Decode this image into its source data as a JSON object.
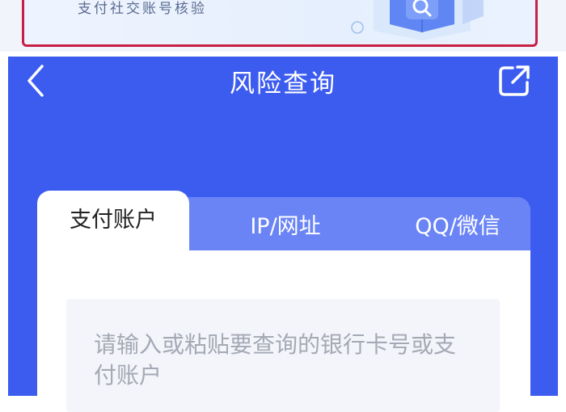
{
  "banner": {
    "subtitle": "支付社交账号核验",
    "illustration_icon": "search-cube-icon"
  },
  "nav": {
    "title": "风险查询",
    "back_icon": "chevron-left-icon",
    "share_icon": "share-external-icon"
  },
  "tabs": [
    {
      "label": "支付账户",
      "active": true
    },
    {
      "label": "IP/网址",
      "active": false
    },
    {
      "label": "QQ/微信",
      "active": false
    }
  ],
  "input": {
    "placeholder": "请输入或粘贴要查询的银行卡号或支付账户",
    "value": ""
  },
  "colors": {
    "primary_blue": "#3c5cf0",
    "tab_inactive": "#6a84f6",
    "highlight_border": "#c81e44",
    "input_bg": "#f3f5fa"
  }
}
